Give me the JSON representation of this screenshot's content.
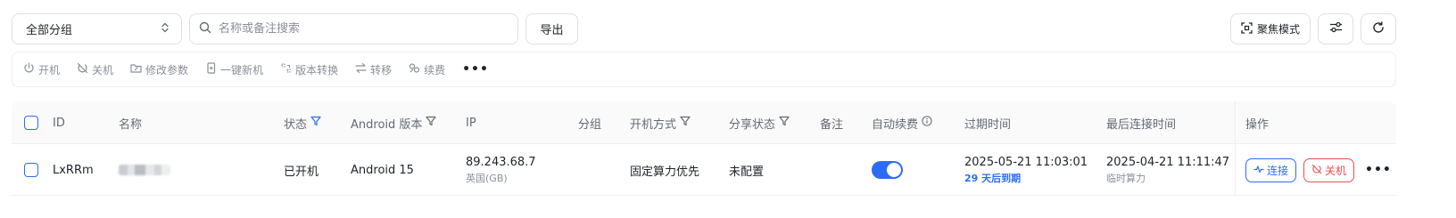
{
  "toolbar": {
    "group_select_value": "全部分组",
    "search_placeholder": "名称或备注搜索",
    "export_label": "导出",
    "focus_mode_label": "聚焦模式"
  },
  "actions": [
    {
      "label": "开机",
      "icon": "power-icon"
    },
    {
      "label": "关机",
      "icon": "power-off-icon"
    },
    {
      "label": "修改参数",
      "icon": "edit-folder-icon"
    },
    {
      "label": "一键新机",
      "icon": "new-device-icon"
    },
    {
      "label": "版本转换",
      "icon": "version-switch-icon"
    },
    {
      "label": "转移",
      "icon": "transfer-icon"
    },
    {
      "label": "续费",
      "icon": "renew-icon"
    }
  ],
  "table": {
    "headers": {
      "id": "ID",
      "name": "名称",
      "status": "状态",
      "android_version": "Android 版本",
      "ip": "IP",
      "group": "分组",
      "boot_mode": "开机方式",
      "share_status": "分享状态",
      "remark": "备注",
      "auto_renew": "自动续费",
      "expire_time": "过期时间",
      "last_connect": "最后连接时间",
      "actions": "操作"
    },
    "rows": [
      {
        "id": "LxRRm",
        "status": "已开机",
        "android_version": "Android 15",
        "ip": "89.243.68.7",
        "ip_region": "英国(GB)",
        "group": "",
        "boot_mode": "固定算力优先",
        "share_status": "未配置",
        "remark": "",
        "auto_renew": true,
        "expire_time": "2025-05-21 11:03:01",
        "expire_note": "29 天后到期",
        "last_connect": "2025-04-21 11:11:47",
        "last_connect_note": "临时算力",
        "connect_label": "连接",
        "shutdown_label": "关机"
      }
    ]
  },
  "colors": {
    "accent": "#2b6cf6",
    "danger": "#f04d4d",
    "muted": "#8a8f99",
    "border": "#dcdfe6"
  }
}
